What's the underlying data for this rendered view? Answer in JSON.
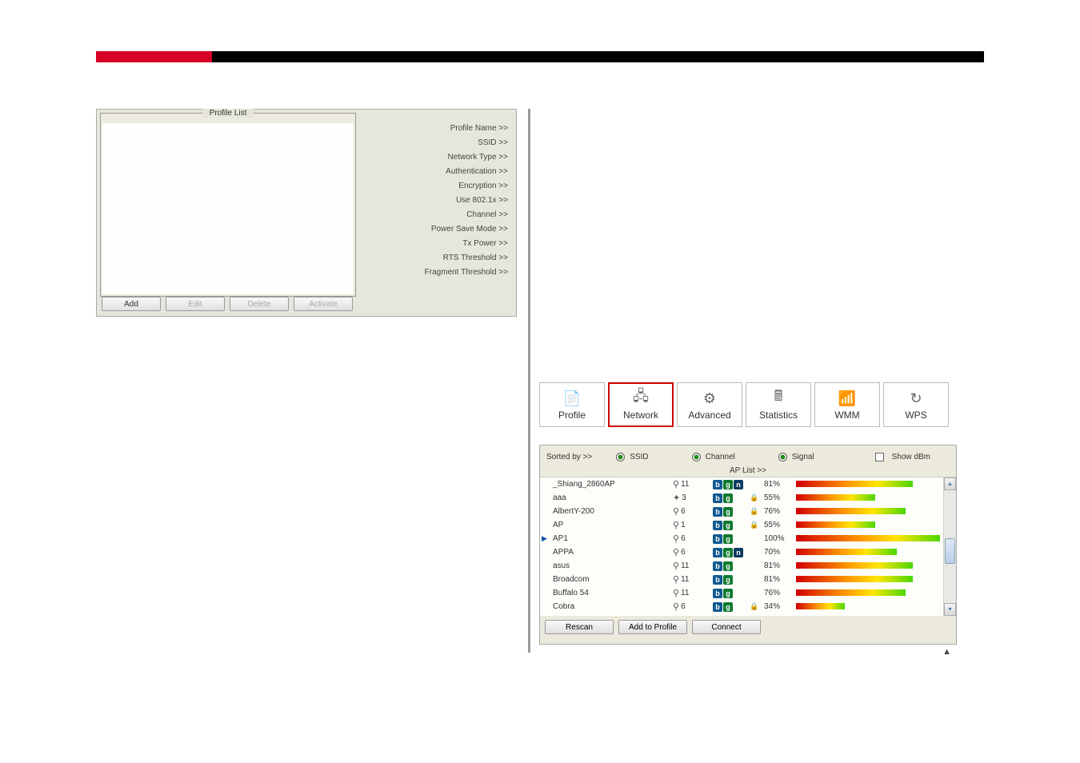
{
  "profile": {
    "list_title": "Profile List",
    "info_labels": [
      "Profile Name >>",
      "SSID >>",
      "Network Type >>",
      "Authentication >>",
      "Encryption >>",
      "Use 802.1x >>",
      "Channel >>",
      "Power Save Mode >>",
      "Tx Power >>",
      "RTS Threshold >>",
      "Fragment Threshold >>"
    ],
    "buttons": {
      "add": "Add",
      "edit": "Edit",
      "delete": "Delete",
      "activate": "Activate"
    }
  },
  "tabs": {
    "profile": "Profile",
    "network": "Network",
    "advanced": "Advanced",
    "statistics": "Statistics",
    "wmm": "WMM",
    "wps": "WPS"
  },
  "network": {
    "sorted_by": "Sorted by >>",
    "sort_ssid": "SSID",
    "sort_channel": "Channel",
    "sort_signal": "Signal",
    "show_dbm": "Show dBm",
    "ap_list": "AP List >>",
    "buttons": {
      "rescan": "Rescan",
      "add_to_profile": "Add to Profile",
      "connect": "Connect"
    },
    "rows": [
      {
        "ssid": "_Shiang_2860AP",
        "chan": "11",
        "modes": [
          "b",
          "g",
          "n"
        ],
        "secure": false,
        "sig": 81,
        "icon": "signal"
      },
      {
        "ssid": "aaa",
        "chan": "3",
        "modes": [
          "b",
          "g"
        ],
        "secure": true,
        "sig": 55,
        "icon": "adhoc"
      },
      {
        "ssid": "AlbertY-200",
        "chan": "6",
        "modes": [
          "b",
          "g"
        ],
        "secure": true,
        "sig": 76,
        "icon": "signal"
      },
      {
        "ssid": "AP",
        "chan": "1",
        "modes": [
          "b",
          "g"
        ],
        "secure": true,
        "sig": 55,
        "icon": "signal"
      },
      {
        "ssid": "AP1",
        "chan": "6",
        "modes": [
          "b",
          "g"
        ],
        "secure": false,
        "sig": 100,
        "icon": "signal",
        "selected": true
      },
      {
        "ssid": "APPA",
        "chan": "6",
        "modes": [
          "b",
          "g",
          "n"
        ],
        "secure": false,
        "sig": 70,
        "icon": "signal"
      },
      {
        "ssid": "asus",
        "chan": "11",
        "modes": [
          "b",
          "g"
        ],
        "secure": false,
        "sig": 81,
        "icon": "signal"
      },
      {
        "ssid": "Broadcom",
        "chan": "11",
        "modes": [
          "b",
          "g"
        ],
        "secure": false,
        "sig": 81,
        "icon": "signal"
      },
      {
        "ssid": "Buffalo 54",
        "chan": "11",
        "modes": [
          "b",
          "g"
        ],
        "secure": false,
        "sig": 76,
        "icon": "signal"
      },
      {
        "ssid": "Cobra",
        "chan": "6",
        "modes": [
          "b",
          "g"
        ],
        "secure": true,
        "sig": 34,
        "icon": "signal"
      }
    ]
  }
}
